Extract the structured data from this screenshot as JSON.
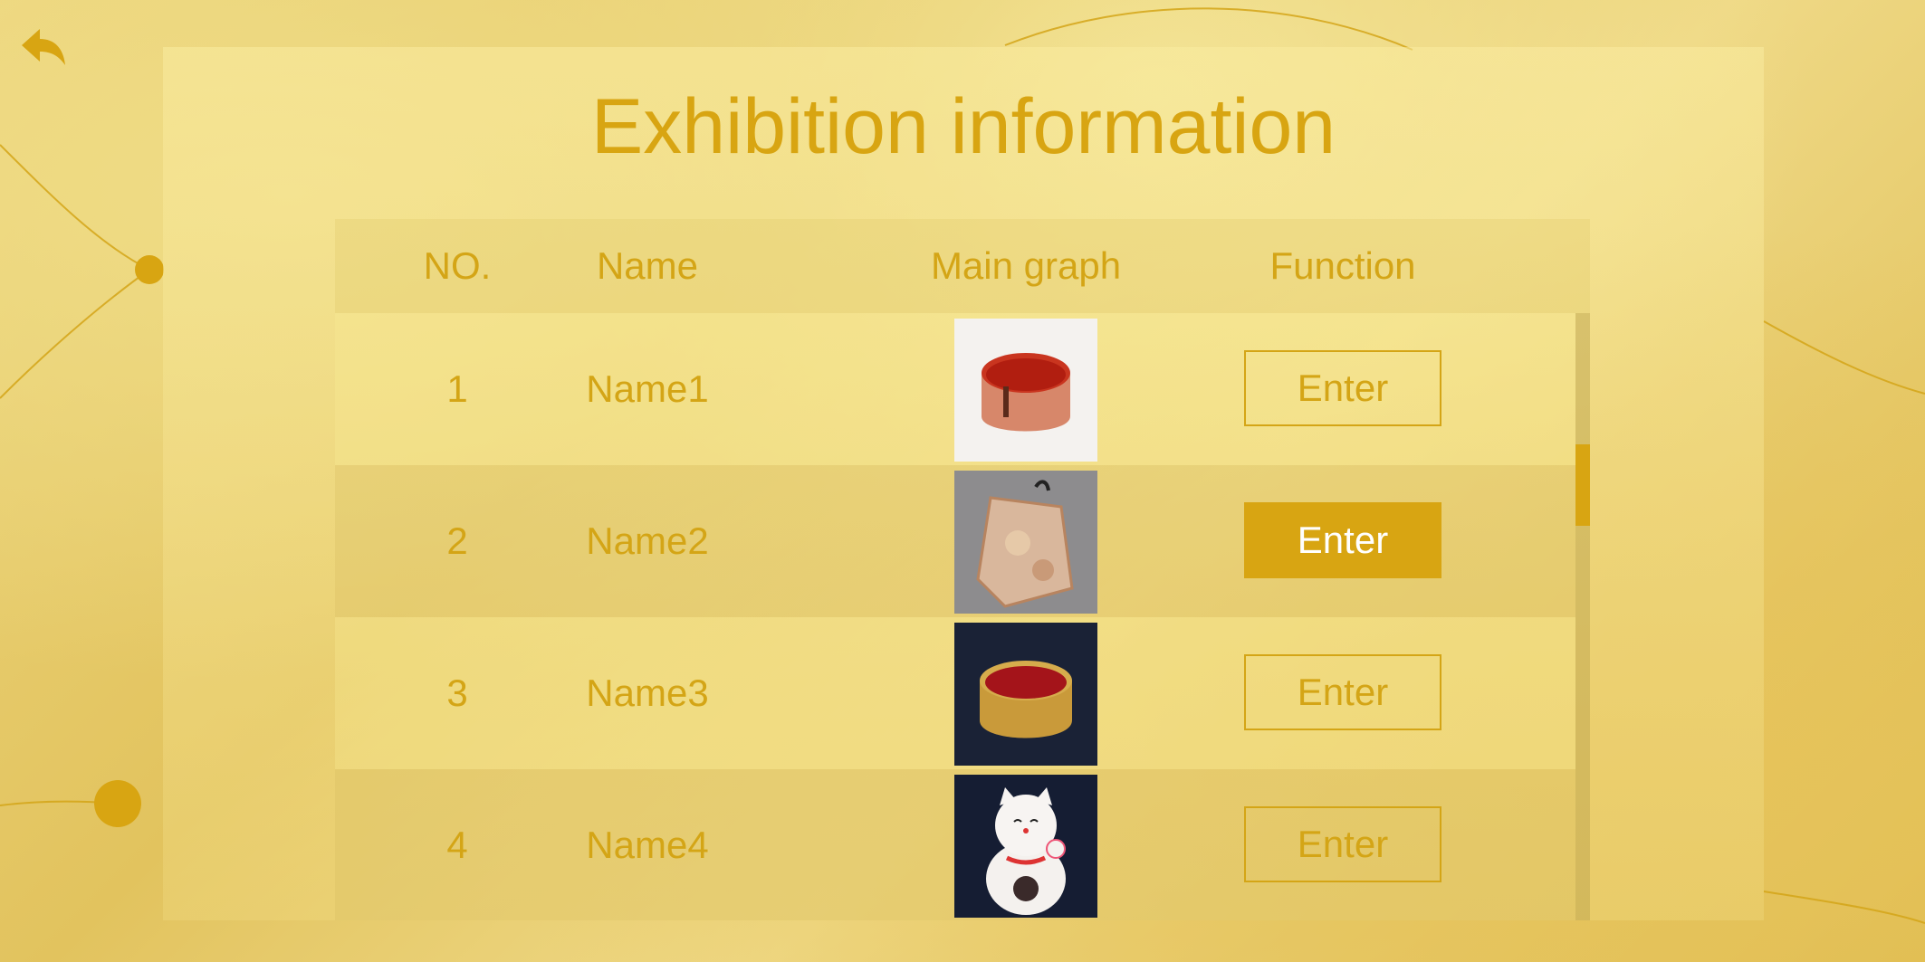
{
  "page_title": "Exhibition information",
  "colors": {
    "accent": "#d8a512",
    "text": "#d4a516",
    "active_button_text": "#ffffff"
  },
  "back_button": {
    "icon": "back-arrow-icon"
  },
  "table": {
    "headers": {
      "no": "NO.",
      "name": "Name",
      "main_graph": "Main graph",
      "function": "Function"
    },
    "rows": [
      {
        "no": "1",
        "name": "Name1",
        "image": "red-lacquer-bowl-on-white",
        "button": "Enter",
        "active": false
      },
      {
        "no": "2",
        "name": "Name2",
        "image": "brocade-pouch-on-gray",
        "button": "Enter",
        "active": true
      },
      {
        "no": "3",
        "name": "Name3",
        "image": "gold-red-lacquer-bowl-on-navy",
        "button": "Enter",
        "active": false
      },
      {
        "no": "4",
        "name": "Name4",
        "image": "lucky-cat-figurine-on-navy",
        "button": "Enter",
        "active": false
      }
    ]
  },
  "scrollbar": {
    "position": 0.25
  }
}
